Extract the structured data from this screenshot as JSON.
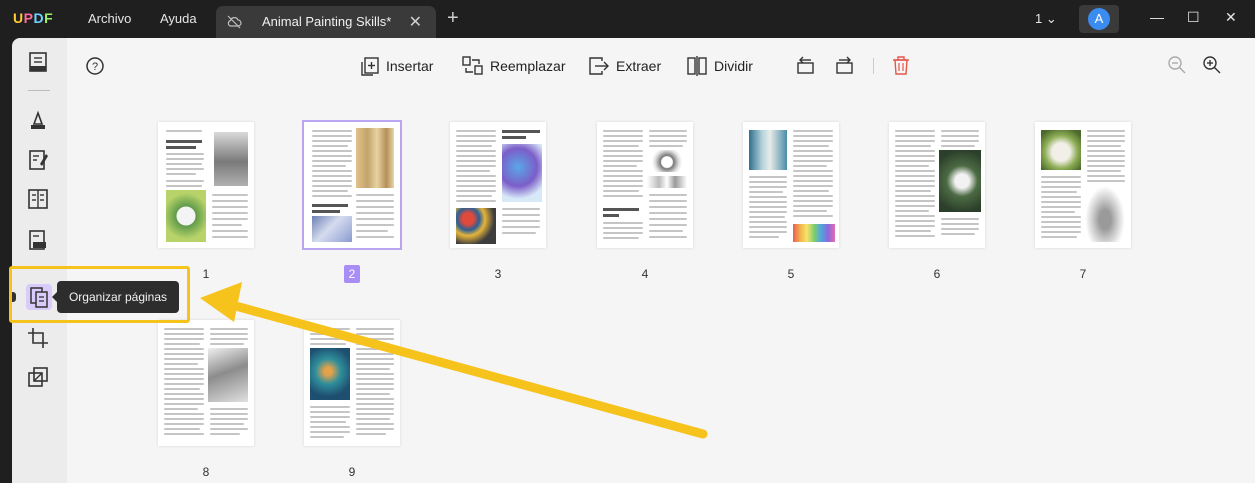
{
  "app": {
    "logo_u": "U",
    "logo_p": "P",
    "logo_d": "D",
    "logo_f": "F",
    "menu": [
      "Archivo",
      "Ayuda"
    ]
  },
  "tab": {
    "title": "Animal Painting Skills*",
    "close": "✕",
    "add": "+"
  },
  "window": {
    "page_select": "1 ⌄",
    "avatar_letter": "A",
    "minimize": "—",
    "maximize": "☐",
    "close": "✕"
  },
  "toolbar": {
    "insert": "Insertar",
    "replace": "Reemplazar",
    "extract": "Extraer",
    "split": "Dividir"
  },
  "tooltip": {
    "text": "Organizar páginas"
  },
  "pages": [
    "1",
    "2",
    "3",
    "4",
    "5",
    "6",
    "7",
    "8",
    "9"
  ],
  "selected_page": "2",
  "colors": {
    "accent": "#a98cf5",
    "highlight": "#f6c21c",
    "titlebar": "#1f1f1f"
  }
}
